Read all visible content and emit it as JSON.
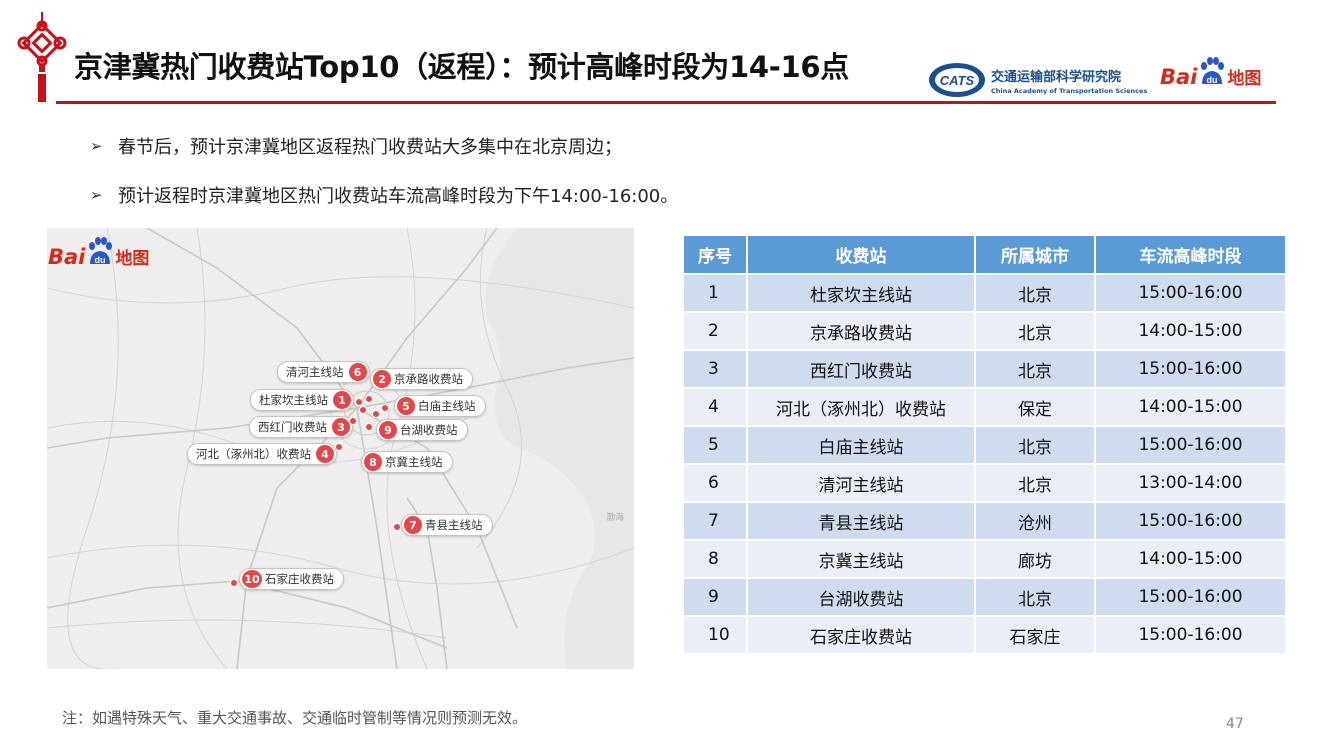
{
  "header": {
    "title": "京津冀热门收费站Top10（返程）：预计高峰时段为14-16点",
    "brand_color": "#c8101a",
    "logos": {
      "cats_cn": "交通运输部科学研究院",
      "cats_en": "China Academy of Transportation Sciences",
      "baidu_bai": "Bai",
      "baidu_du": "du",
      "baidu_map": "地图"
    }
  },
  "bullets": [
    "春节后，预计京津冀地区返程热门收费站大多集中在北京周边；",
    "预计返程时京津冀地区热门收费站车流高峰时段为下午14:00-16:00。"
  ],
  "bullet_icon": "arrow-bullet-icon",
  "map": {
    "marker_color": "#e2474b",
    "markers": [
      {
        "num": "1",
        "label": "杜家坎主线站"
      },
      {
        "num": "2",
        "label": "京承路收费站"
      },
      {
        "num": "3",
        "label": "西红门收费站"
      },
      {
        "num": "4",
        "label": "河北（涿州北）收费站"
      },
      {
        "num": "5",
        "label": "白庙主线站"
      },
      {
        "num": "6",
        "label": "清河主线站"
      },
      {
        "num": "7",
        "label": "青县主线站"
      },
      {
        "num": "8",
        "label": "京冀主线站"
      },
      {
        "num": "9",
        "label": "台湖收费站"
      },
      {
        "num": "10",
        "label": "石家庄收费站"
      }
    ],
    "sea_label": "渤海"
  },
  "table": {
    "header_color": "#5b9bd5",
    "headers": [
      "序号",
      "收费站",
      "所属城市",
      "车流高峰时段"
    ],
    "rows": [
      [
        "1",
        "杜家坎主线站",
        "北京",
        "15:00-16:00"
      ],
      [
        "2",
        "京承路收费站",
        "北京",
        "14:00-15:00"
      ],
      [
        "3",
        "西红门收费站",
        "北京",
        "15:00-16:00"
      ],
      [
        "4",
        "河北（涿州北）收费站",
        "保定",
        "14:00-15:00"
      ],
      [
        "5",
        "白庙主线站",
        "北京",
        "15:00-16:00"
      ],
      [
        "6",
        "清河主线站",
        "北京",
        "13:00-14:00"
      ],
      [
        "7",
        "青县主线站",
        "沧州",
        "15:00-16:00"
      ],
      [
        "8",
        "京冀主线站",
        "廊坊",
        "14:00-15:00"
      ],
      [
        "9",
        "台湖收费站",
        "北京",
        "15:00-16:00"
      ],
      [
        "10",
        "石家庄收费站",
        "石家庄",
        "15:00-16:00"
      ]
    ]
  },
  "footer": {
    "note": "注：如遇特殊天气、重大交通事故、交通临时管制等情况则预测无效。",
    "page_number": "47"
  }
}
